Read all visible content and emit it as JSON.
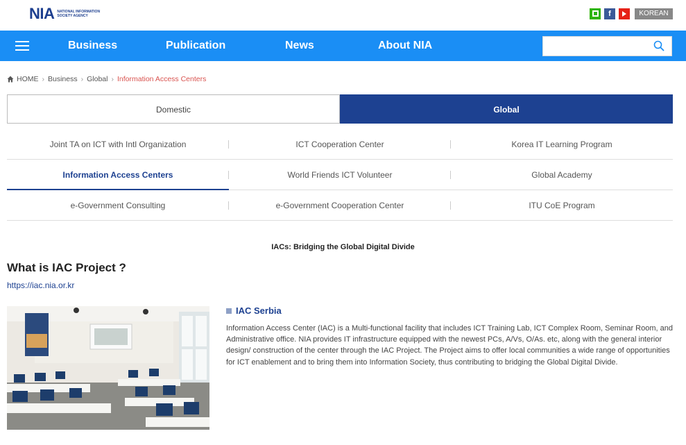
{
  "header": {
    "logo_mark": "NIA",
    "logo_sub": "NATIONAL INFORMATION SOCIETY AGENCY",
    "social": [
      "blog-icon",
      "facebook-icon",
      "youtube-icon"
    ],
    "lang_label": "KOREAN"
  },
  "nav": {
    "items": [
      "Business",
      "Publication",
      "News",
      "About NIA"
    ],
    "search_placeholder": ""
  },
  "breadcrumb": {
    "home": "HOME",
    "items": [
      "Business",
      "Global"
    ],
    "current": "Information Access Centers"
  },
  "tabs": [
    "Domestic",
    "Global"
  ],
  "submenu": [
    [
      "Joint TA on ICT with Intl Organization",
      "ICT Cooperation Center",
      "Korea IT Learning Program"
    ],
    [
      "Information Access Centers",
      "World Friends ICT Volunteer",
      "Global Academy"
    ],
    [
      "e-Government Consulting",
      "e-Government Cooperation Center",
      "ITU CoE Program"
    ]
  ],
  "content": {
    "center_title": "IACs: Bridging the Global Digital Divide",
    "heading": "What is IAC Project ?",
    "link": "https://iac.nia.or.kr",
    "section_title": "IAC Serbia",
    "description": "Information Access Center (IAC) is a Multi-functional facility that includes ICT Training Lab, ICT Complex Room, Seminar Room, and Administrative office. NIA provides IT infrastructure equipped with the newest PCs, A/Vs, O/As. etc, along with the general interior design/ construction of the center through the IAC Project. The Project aims to offer local communities a wide range of opportunities for ICT enablement and to bring them into Information Society, thus contributing to bridging the Global Digital Divide."
  },
  "colors": {
    "nav_blue": "#1a8ef5",
    "active_navy": "#1d4191",
    "breadcrumb_current": "#d9534f"
  }
}
